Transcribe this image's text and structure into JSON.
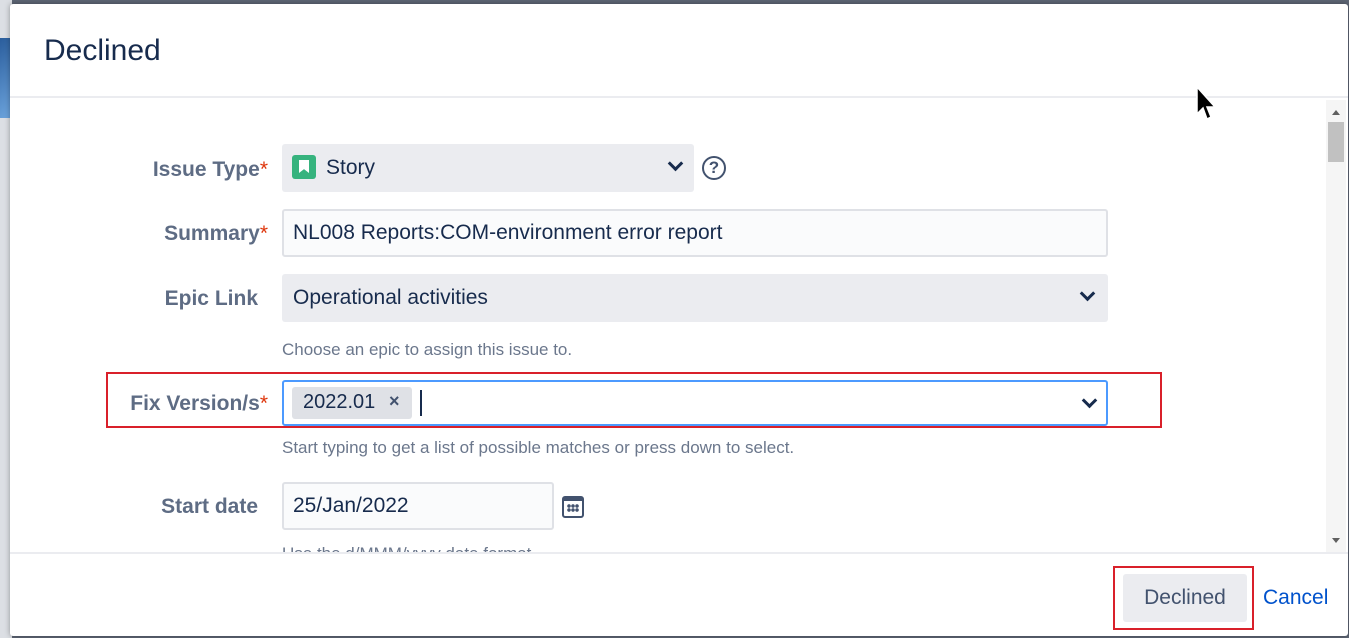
{
  "dialog": {
    "title": "Declined"
  },
  "fields": {
    "issue_type": {
      "label": "Issue Type",
      "required_mark": "*",
      "value": "Story"
    },
    "summary": {
      "label": "Summary",
      "required_mark": "*",
      "value": "NL008 Reports:COM-environment error report"
    },
    "epic_link": {
      "label": "Epic Link",
      "value": "Operational activities",
      "hint": "Choose an epic to assign this issue to."
    },
    "fix_versions": {
      "label": "Fix Version/s",
      "required_mark": "*",
      "tags": [
        "2022.01"
      ],
      "tag_remove": "×",
      "hint": "Start typing to get a list of possible matches or press down to select."
    },
    "start_date": {
      "label": "Start date",
      "value": "25/Jan/2022",
      "hint": "Use the d/MMM/yyyy date format."
    }
  },
  "help": {
    "glyph": "?"
  },
  "footer": {
    "declined_label": "Declined",
    "cancel_label": "Cancel"
  },
  "icons": {
    "story": "story-icon",
    "help": "help-icon",
    "chevron": "chevron-down-icon",
    "calendar": "calendar-icon",
    "pointer": "mouse-pointer-icon"
  },
  "colors": {
    "required": "#de350b",
    "focus_border": "#4c9aff",
    "story_icon": "#36b37e",
    "link": "#0052cc",
    "annotation": "#d9202a"
  }
}
